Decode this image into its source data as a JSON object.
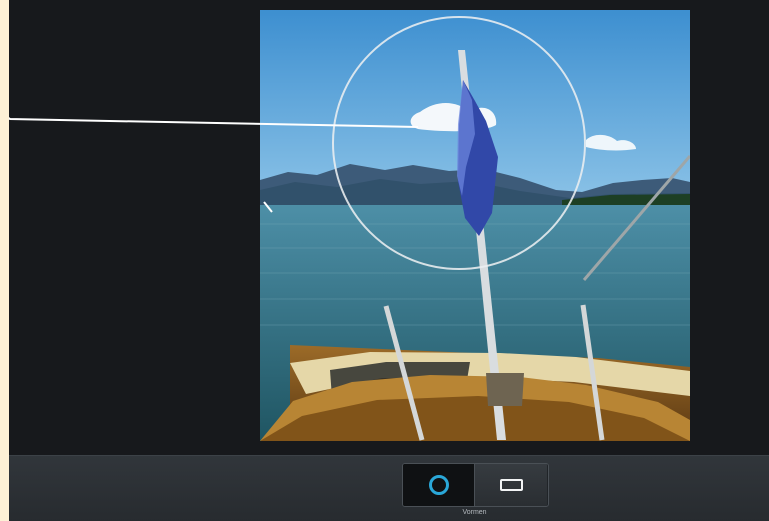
{
  "editor": {
    "canvas_description": "photo-preview",
    "shapes_label": "Vormen",
    "shape_options": [
      {
        "name": "circle-shape",
        "selected": true
      },
      {
        "name": "rectangle-shape",
        "selected": false
      }
    ],
    "accent_color": "#2aa7d8"
  }
}
